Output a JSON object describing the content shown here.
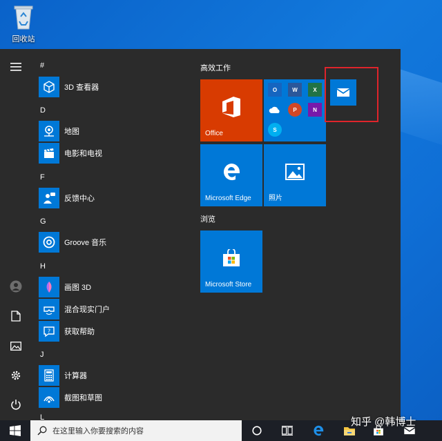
{
  "desktop": {
    "recycle_bin_label": "回收站",
    "recycle_bin_icon": "recycle-bin-icon"
  },
  "start_menu": {
    "rail": {
      "menu_icon": "hamburger-icon",
      "user_icon": "user-icon",
      "documents_icon": "document-icon",
      "pictures_icon": "picture-icon",
      "settings_icon": "gear-icon",
      "power_icon": "power-icon"
    },
    "app_list": {
      "sections": [
        {
          "letter": "#",
          "apps": [
            {
              "name": "3D 查看器",
              "icon": "cube-icon"
            }
          ]
        },
        {
          "letter": "D",
          "apps": [
            {
              "name": "地图",
              "icon": "maps-icon"
            },
            {
              "name": "电影和电视",
              "icon": "film-icon"
            }
          ]
        },
        {
          "letter": "F",
          "apps": [
            {
              "name": "反馈中心",
              "icon": "feedback-icon"
            }
          ]
        },
        {
          "letter": "G",
          "apps": [
            {
              "name": "Groove 音乐",
              "icon": "groove-icon"
            }
          ]
        },
        {
          "letter": "H",
          "apps": [
            {
              "name": "画图 3D",
              "icon": "paint3d-icon"
            },
            {
              "name": "混合现实门户",
              "icon": "mixed-reality-icon"
            },
            {
              "name": "获取帮助",
              "icon": "help-icon"
            }
          ]
        },
        {
          "letter": "J",
          "apps": [
            {
              "name": "计算器",
              "icon": "calculator-icon"
            },
            {
              "name": "截图和草图",
              "icon": "snip-icon"
            }
          ]
        }
      ],
      "bottom_letter": "L"
    },
    "tiles": {
      "group1_title": "高效工作",
      "group2_title": "浏览",
      "office_label": "Office",
      "edge_label": "Microsoft Edge",
      "photos_label": "照片",
      "store_label": "Microsoft Store",
      "office_apps": [
        "O",
        "W",
        "X",
        "",
        "P",
        "N"
      ],
      "skype_letter": "S",
      "mail_icon": "mail-icon"
    },
    "colors": {
      "menu_bg": "#2b2b2b",
      "accent": "#0078d7",
      "office_tile": "#d83b01",
      "highlight": "#e0242b"
    }
  },
  "taskbar": {
    "start_icon": "windows-logo-icon",
    "search_placeholder": "在这里输入你要搜索的内容",
    "search_icon": "search-icon",
    "cortana_icon": "cortana-icon",
    "task_view_icon": "task-view-icon",
    "edge_icon": "edge-icon",
    "explorer_icon": "folder-icon",
    "store_icon": "store-icon",
    "mail_icon": "mail-icon"
  },
  "watermark": "知乎 @韩博士"
}
